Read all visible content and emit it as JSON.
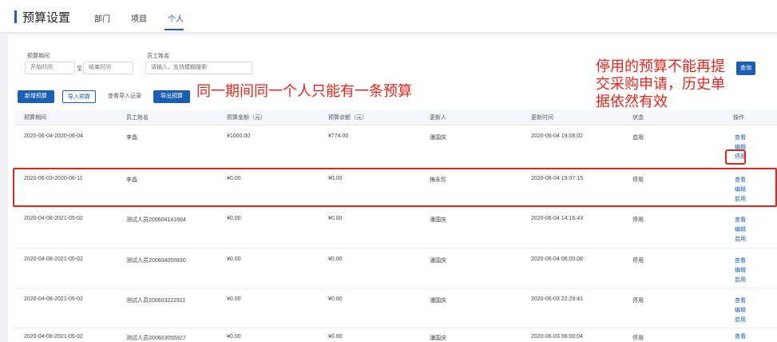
{
  "header": {
    "title": "预算设置",
    "tabs": [
      {
        "label": "部门"
      },
      {
        "label": "项目"
      },
      {
        "label": "个人"
      }
    ]
  },
  "filters": {
    "period_label": "预算期间",
    "start_placeholder": "开始时间",
    "to_label": "至",
    "end_placeholder": "结束时间",
    "employee_label": "员工姓名",
    "employee_placeholder": "请输入，支持模糊搜索",
    "query_button": "查询"
  },
  "toolbar": {
    "add": "新增预算",
    "import": "导入预算",
    "import_records": "查看导入记录",
    "export": "导出预算"
  },
  "annotations": {
    "middle": "同一期间同一个人只能有一条预算",
    "right": [
      "停用的预算不能再提",
      "交采购申请，历史单",
      "据依然有效"
    ]
  },
  "table": {
    "columns": [
      "预算期间",
      "员工姓名",
      "预算金额（元）",
      "预算余额（元）",
      "更新人",
      "更新时间",
      "状态",
      "操作"
    ],
    "rows": [
      {
        "period": "2020-06-04-2020-06-04",
        "name": "李晶",
        "amount": "¥1000.00",
        "balance": "¥774.00",
        "updater": "潘国庆",
        "updated": "2020-06-04 19:08:02",
        "status": "启用",
        "actions": [
          "查看",
          "编辑",
          "停用"
        ]
      },
      {
        "period": "2020-06-03-2020-06-11",
        "name": "李晶",
        "amount": "¥0.00",
        "balance": "¥0.00",
        "updater": "梅永珍",
        "updated": "2020-06-04 19:07:15",
        "status": "停用",
        "actions": [
          "查看",
          "编辑",
          "启用"
        ]
      },
      {
        "period": "2020-04-08-2021-05-02",
        "name": "测试人员200604141604",
        "amount": "¥0.00",
        "balance": "¥0.00",
        "updater": "潘国庆",
        "updated": "2020-06-04 14:16:43",
        "status": "停用",
        "actions": [
          "查看",
          "编辑",
          "启用"
        ]
      },
      {
        "period": "2020-04-08-2021-05-02",
        "name": "测试人员200604055930",
        "amount": "¥0.00",
        "balance": "¥0.00",
        "updater": "潘国庆",
        "updated": "2020-06-04 06:00:08",
        "status": "停用",
        "actions": [
          "查看",
          "编辑",
          "启用"
        ]
      },
      {
        "period": "2020-04-08-2021-05-02",
        "name": "测试人员200603222911",
        "amount": "¥0.00",
        "balance": "¥0.00",
        "updater": "潘国庆",
        "updated": "2020-06-03 22:29:41",
        "status": "停用",
        "actions": [
          "查看",
          "编辑",
          "启用"
        ]
      },
      {
        "period": "2020-04-08-2021-05-02",
        "name": "测试人员200603055927",
        "amount": "¥0.00",
        "balance": "¥0.00",
        "updater": "潘国庆",
        "updated": "2020-06-03 06:00:04",
        "status": "停用",
        "actions": [
          "查看"
        ]
      }
    ]
  },
  "colors": {
    "accent": "#1a5fb4",
    "annotation": "#e8241a"
  }
}
